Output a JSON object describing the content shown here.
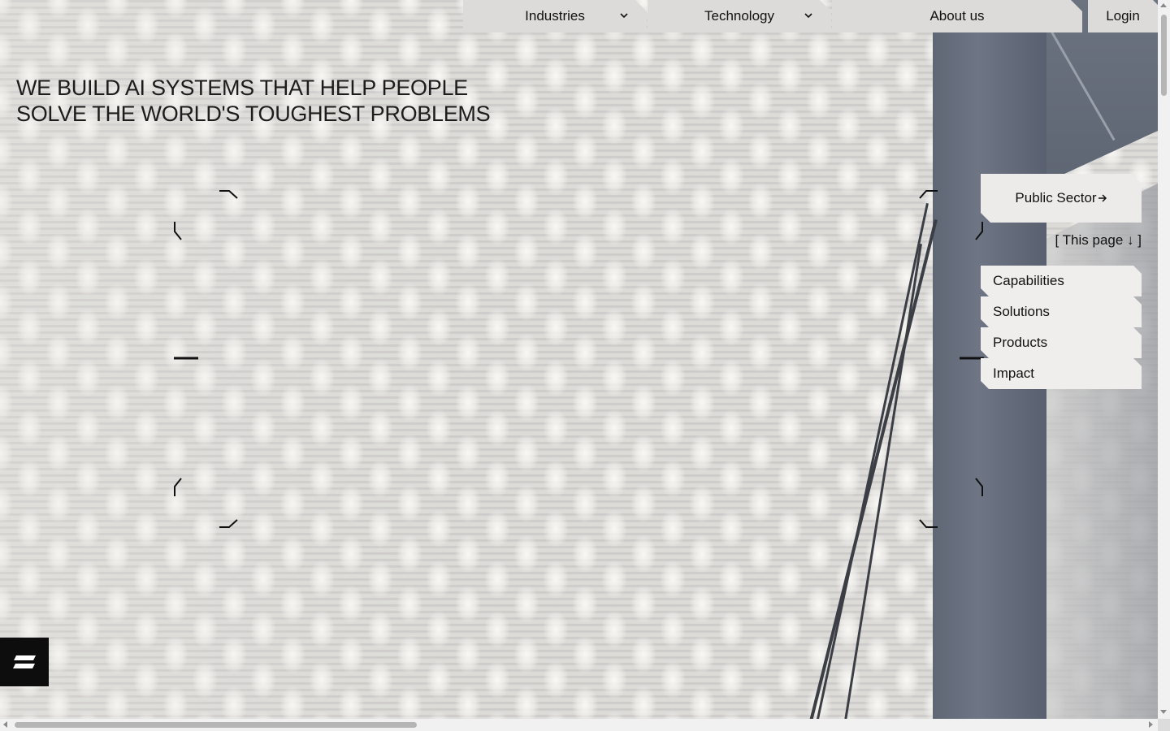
{
  "nav": {
    "items": [
      {
        "label": "Industries",
        "has_dropdown": true
      },
      {
        "label": "Technology",
        "has_dropdown": true
      },
      {
        "label": "About us",
        "has_dropdown": false
      }
    ],
    "login_label": "Login"
  },
  "hero": {
    "line1": "WE BUILD AI SYSTEMS THAT HELP PEOPLE",
    "line2": "SOLVE THE WORLD'S TOUGHEST PROBLEMS"
  },
  "sector": {
    "button_label": "Public Sector",
    "button_icon": "arrow-right-icon",
    "this_page_label": "[ This page ↓ ]"
  },
  "page_links": [
    {
      "label": "Capabilities"
    },
    {
      "label": "Solutions"
    },
    {
      "label": "Products"
    },
    {
      "label": "Impact"
    }
  ],
  "menu": {
    "icon": "menu-icon"
  },
  "colors": {
    "nav_bg": "#dcdbd9",
    "panel_bg": "#efeeec",
    "menu_bg": "#0d0d0d",
    "text": "#111111"
  }
}
